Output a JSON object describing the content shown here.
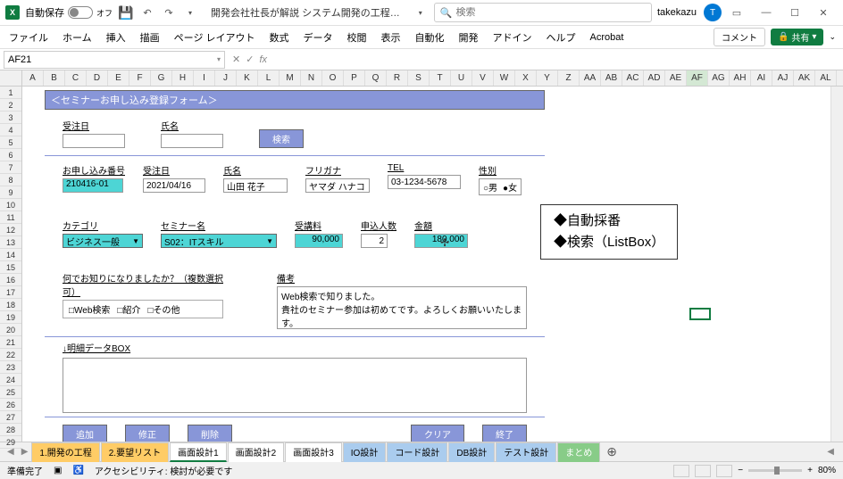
{
  "titlebar": {
    "autosave_label": "自動保存",
    "autosave_state": "オフ",
    "file_title": "開発会社社長が解説 システム開発の工程…",
    "search_placeholder": "検索",
    "user_name": "takekazu",
    "user_initial": "T"
  },
  "ribbon": {
    "tabs": [
      "ファイル",
      "ホーム",
      "挿入",
      "描画",
      "ページ レイアウト",
      "数式",
      "データ",
      "校閲",
      "表示",
      "自動化",
      "開発",
      "アドイン",
      "ヘルプ",
      "Acrobat"
    ],
    "comment_label": "コメント",
    "share_label": "共有"
  },
  "name_box": "AF21",
  "columns": [
    "A",
    "B",
    "C",
    "D",
    "E",
    "F",
    "G",
    "H",
    "I",
    "J",
    "K",
    "L",
    "M",
    "N",
    "O",
    "P",
    "Q",
    "R",
    "S",
    "T",
    "U",
    "V",
    "W",
    "X",
    "Y",
    "Z",
    "AA",
    "AB",
    "AC",
    "AD",
    "AE",
    "AF",
    "AG",
    "AH",
    "AI",
    "AJ",
    "AK",
    "AL"
  ],
  "active_col": "AF",
  "rows": [
    1,
    2,
    3,
    4,
    5,
    6,
    7,
    8,
    9,
    10,
    11,
    12,
    13,
    14,
    15,
    16,
    17,
    18,
    19,
    20,
    21,
    22,
    23,
    24,
    25,
    26,
    27,
    28,
    29
  ],
  "form": {
    "title": "＜セミナーお申し込み登録フォーム＞",
    "search_date_label": "受注日",
    "search_name_label": "氏名",
    "search_btn": "検索",
    "appno_label": "お申し込み番号",
    "appno_value": "210416-01",
    "orderdate_label": "受注日",
    "orderdate_value": "2021/04/16",
    "name_label": "氏名",
    "name_value": "山田 花子",
    "kana_label": "フリガナ",
    "kana_value": "ヤマダ ハナコ",
    "tel_label": "TEL",
    "tel_value": "03-1234-5678",
    "gender_label": "性別",
    "gender_male": "○男",
    "gender_female": "●女",
    "category_label": "カテゴリ",
    "category_value": "ビジネス一般",
    "seminar_label": "セミナー名",
    "seminar_value": "S02：ITスキル",
    "fee_label": "受講料",
    "fee_value": "90,000",
    "count_label": "申込人数",
    "count_value": "2",
    "amount_label": "金額",
    "amount_value": "180,000",
    "know_label": "何でお知りになりましたか？（複数選択可）",
    "know_opts": [
      "□Web検索",
      "□紹介",
      "□その他"
    ],
    "memo_label": "備考",
    "memo_value": "Web検索で知りました。\n貴社のセミナー参加は初めてです。よろしくお願いいたします。",
    "detail_label": "↓明細データBOX",
    "btn_add": "追加",
    "btn_edit": "修正",
    "btn_del": "削除",
    "btn_clear": "クリア",
    "btn_end": "終了"
  },
  "callout": {
    "line1": "◆自動採番",
    "line2": "◆検索（ListBox）"
  },
  "sheet_tabs": [
    {
      "label": "1.開発の工程",
      "cls": "tab-orange"
    },
    {
      "label": "2.要望リスト",
      "cls": "tab-orange"
    },
    {
      "label": "画面設計1",
      "cls": "tab-white tab-active"
    },
    {
      "label": "画面設計2",
      "cls": "tab-white"
    },
    {
      "label": "画面設計3",
      "cls": "tab-white"
    },
    {
      "label": "IO設計",
      "cls": "tab-blue"
    },
    {
      "label": "コード設計",
      "cls": "tab-blue"
    },
    {
      "label": "DB設計",
      "cls": "tab-blue"
    },
    {
      "label": "テスト設計",
      "cls": "tab-blue"
    },
    {
      "label": "まとめ",
      "cls": "tab-green"
    }
  ],
  "status": {
    "ready": "準備完了",
    "a11y": "アクセシビリティ: 検討が必要です",
    "zoom": "80%"
  }
}
